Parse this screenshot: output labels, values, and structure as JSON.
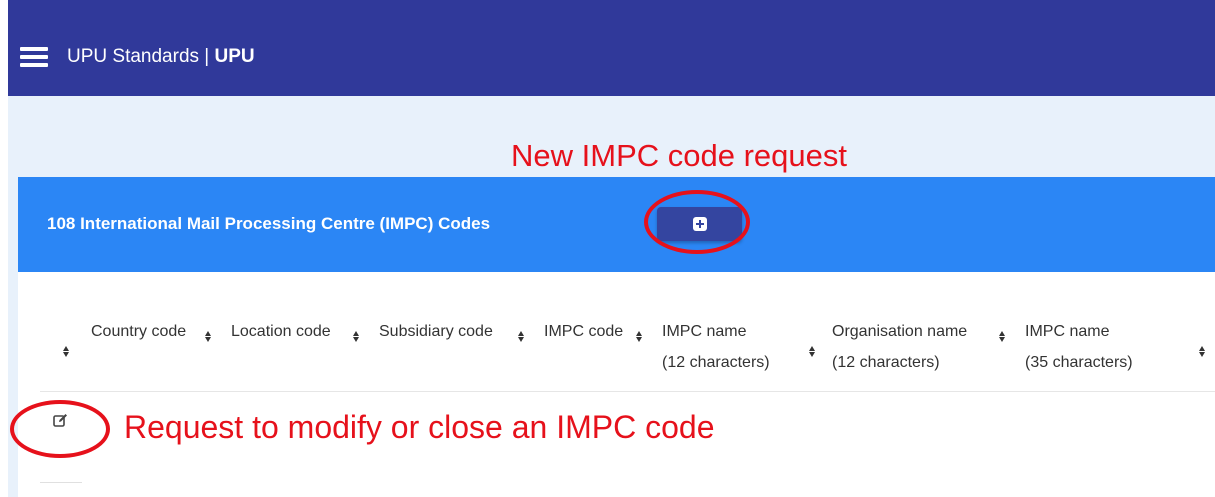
{
  "appbar": {
    "title_prefix": "UPU Standards | ",
    "title_bold": "UPU"
  },
  "annotations": {
    "new_request": "New IMPC code request",
    "modify_request": "Request to modify or close an IMPC code"
  },
  "card": {
    "title": "108 International Mail Processing Centre (IMPC) Codes",
    "add_icon": "plus-square-icon"
  },
  "table": {
    "columns": [
      {
        "line1": "Country code",
        "line2": ""
      },
      {
        "line1": "Location code",
        "line2": ""
      },
      {
        "line1": "Subsidiary code",
        "line2": ""
      },
      {
        "line1": "IMPC code",
        "line2": ""
      },
      {
        "line1": "IMPC name",
        "line2": "(12 characters)"
      },
      {
        "line1": "Organisation name",
        "line2": "(12 characters)"
      },
      {
        "line1": "IMPC name",
        "line2": "(35 characters)"
      }
    ],
    "row_action_icon": "edit-icon",
    "sort_icon": "sort-icon"
  },
  "colors": {
    "appbar": "#30399a",
    "card_header": "#2b86f5",
    "add_button": "#3445a0",
    "annotation": "#e6111b",
    "page_bg": "#e8f1fb"
  }
}
